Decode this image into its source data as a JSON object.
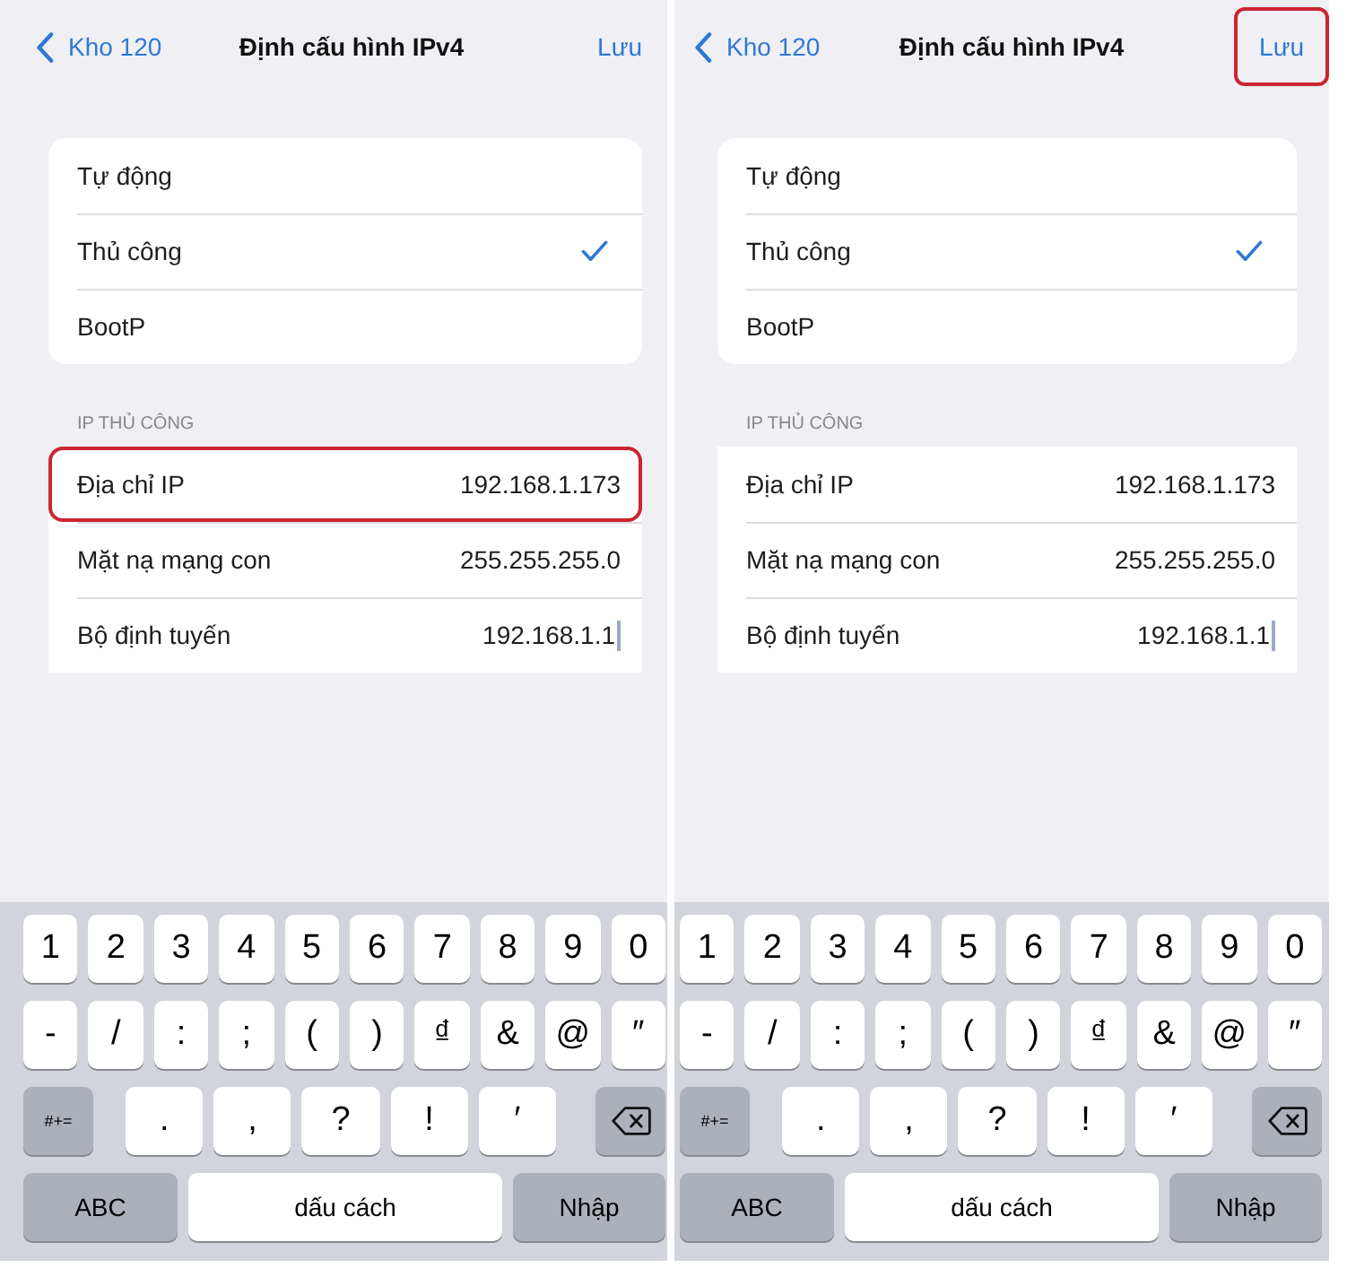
{
  "screens": [
    {
      "nav": {
        "back": "Kho 120",
        "title": "Định cấu hình IPv4",
        "action": "Lưu",
        "action_highlighted": false
      },
      "modes": [
        {
          "label": "Tự động",
          "selected": false
        },
        {
          "label": "Thủ công",
          "selected": true
        },
        {
          "label": "BootP",
          "selected": false
        }
      ],
      "section_header": "IP THỦ CÔNG",
      "fields": [
        {
          "label": "Địa chỉ IP",
          "value": "192.168.1.173",
          "highlighted": true,
          "focused": false
        },
        {
          "label": "Mặt nạ mạng con",
          "value": "255.255.255.0",
          "highlighted": false,
          "focused": false
        },
        {
          "label": "Bộ định tuyến",
          "value": "192.168.1.1",
          "highlighted": false,
          "focused": true
        }
      ],
      "keyboard": [
        [
          {
            "label": "1",
            "kind": "char"
          },
          {
            "label": "2",
            "kind": "char"
          },
          {
            "label": "3",
            "kind": "char"
          },
          {
            "label": "4",
            "kind": "char"
          },
          {
            "label": "5",
            "kind": "char"
          },
          {
            "label": "6",
            "kind": "char"
          },
          {
            "label": "7",
            "kind": "char"
          },
          {
            "label": "8",
            "kind": "char"
          },
          {
            "label": "9",
            "kind": "char"
          },
          {
            "label": "0",
            "kind": "char"
          }
        ],
        [
          {
            "label": "-",
            "kind": "char"
          },
          {
            "label": "/",
            "kind": "char"
          },
          {
            "label": ":",
            "kind": "char"
          },
          {
            "label": ";",
            "kind": "char"
          },
          {
            "label": "(",
            "kind": "char"
          },
          {
            "label": ")",
            "kind": "char"
          },
          {
            "label": "₫",
            "kind": "char"
          },
          {
            "label": "&",
            "kind": "char"
          },
          {
            "label": "@",
            "kind": "char"
          },
          {
            "label": "″",
            "kind": "char"
          }
        ],
        [
          {
            "label": "#+=",
            "kind": "symbols"
          },
          {
            "label": ".",
            "kind": "punct"
          },
          {
            "label": ",",
            "kind": "punct"
          },
          {
            "label": "?",
            "kind": "punct"
          },
          {
            "label": "!",
            "kind": "punct"
          },
          {
            "label": "′",
            "kind": "punct"
          },
          {
            "kind": "delete"
          }
        ],
        [
          {
            "label": "ABC",
            "kind": "letters"
          },
          {
            "label": "dấu cách",
            "kind": "space"
          },
          {
            "label": "Nhập",
            "kind": "return"
          }
        ]
      ]
    },
    {
      "nav": {
        "back": "Kho 120",
        "title": "Định cấu hình IPv4",
        "action": "Lưu",
        "action_highlighted": true
      },
      "modes": [
        {
          "label": "Tự động",
          "selected": false
        },
        {
          "label": "Thủ công",
          "selected": true
        },
        {
          "label": "BootP",
          "selected": false
        }
      ],
      "section_header": "IP THỦ CÔNG",
      "fields": [
        {
          "label": "Địa chỉ IP",
          "value": "192.168.1.173",
          "highlighted": false,
          "focused": false
        },
        {
          "label": "Mặt nạ mạng con",
          "value": "255.255.255.0",
          "highlighted": false,
          "focused": false
        },
        {
          "label": "Bộ định tuyến",
          "value": "192.168.1.1",
          "highlighted": false,
          "focused": true
        }
      ],
      "keyboard": [
        [
          {
            "label": "1",
            "kind": "char"
          },
          {
            "label": "2",
            "kind": "char"
          },
          {
            "label": "3",
            "kind": "char"
          },
          {
            "label": "4",
            "kind": "char"
          },
          {
            "label": "5",
            "kind": "char"
          },
          {
            "label": "6",
            "kind": "char"
          },
          {
            "label": "7",
            "kind": "char"
          },
          {
            "label": "8",
            "kind": "char"
          },
          {
            "label": "9",
            "kind": "char"
          },
          {
            "label": "0",
            "kind": "char"
          }
        ],
        [
          {
            "label": "-",
            "kind": "char"
          },
          {
            "label": "/",
            "kind": "char"
          },
          {
            "label": ":",
            "kind": "char"
          },
          {
            "label": ";",
            "kind": "char"
          },
          {
            "label": "(",
            "kind": "char"
          },
          {
            "label": ")",
            "kind": "char"
          },
          {
            "label": "₫",
            "kind": "char"
          },
          {
            "label": "&",
            "kind": "char"
          },
          {
            "label": "@",
            "kind": "char"
          },
          {
            "label": "″",
            "kind": "char"
          }
        ],
        [
          {
            "label": "#+=",
            "kind": "symbols"
          },
          {
            "label": ".",
            "kind": "punct"
          },
          {
            "label": ",",
            "kind": "punct"
          },
          {
            "label": "?",
            "kind": "punct"
          },
          {
            "label": "!",
            "kind": "punct"
          },
          {
            "label": "′",
            "kind": "punct"
          },
          {
            "kind": "delete"
          }
        ],
        [
          {
            "label": "ABC",
            "kind": "letters"
          },
          {
            "label": "dấu cách",
            "kind": "space"
          },
          {
            "label": "Nhập",
            "kind": "return"
          }
        ]
      ]
    }
  ]
}
